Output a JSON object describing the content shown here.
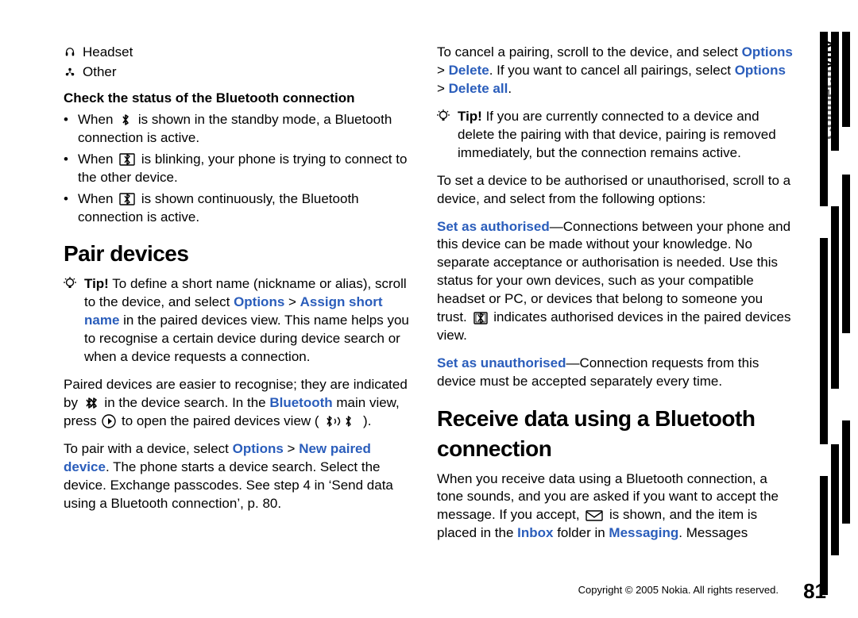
{
  "sidetab": {
    "prefix": "Connecti",
    "suffix": "vity"
  },
  "devlist": [
    {
      "icon": "headset",
      "label": "Headset"
    },
    {
      "icon": "other",
      "label": "Other"
    }
  ],
  "col1": {
    "checkHeading": "Check the status of the Bluetooth connection",
    "bul1a": "When ",
    "bul1b": " is shown in the standby mode, a Bluetooth connection is active.",
    "bul2a": "When ",
    "bul2b": " is blinking, your phone is trying to connect to the other device.",
    "bul3a": "When ",
    "bul3b": " is shown continuously, the Bluetooth connection is active.",
    "pairHeading": "Pair devices",
    "tip1a": "Tip!",
    "tip1b": " To define a short name (nickname or alias), scroll to the device, and select ",
    "tip1c": "Options",
    "tip1d": " > ",
    "tip1e": "Assign short name",
    "tip1f": " in the paired devices view. This name helps you to recognise a certain device during device search or when a device requests a connection.",
    "p1a": "Paired devices are easier to recognise; they are indicated by ",
    "p1b": " in the device search. In the ",
    "p1c": "Bluetooth",
    "p1d": " main view, press ",
    "p1e": " to open the paired devices view ( ",
    "p1f": " ).",
    "p2a": "To pair with a device, select ",
    "p2b": "Options",
    "p2c": " > ",
    "p2d": "New paired device",
    "p2e": ". The phone starts a device search. Select the device. Exchange passcodes. See step 4 in ‘Send data using a Bluetooth connection’, p. 80."
  },
  "col2": {
    "p1a": "To cancel a pairing, scroll to the device, and select ",
    "p1b": "Options",
    "p1c": " > ",
    "p1d": "Delete",
    "p1e": ". If you want to cancel all pairings, select ",
    "p1f": "Options",
    "p1g": " > ",
    "p1h": "Delete all",
    "p1i": ".",
    "tip1a": "Tip!",
    "tip1b": " If you are currently connected to a device and delete the pairing with that device, pairing is removed immediately, but the connection remains active.",
    "p2": "To set a device to be authorised or unauthorised, scroll to a device, and select from the following options:",
    "p3a": "Set as authorised",
    "p3b": "—Connections between your phone and this device can be made without your knowledge. No separate acceptance or authorisation is needed. Use this status for your own devices, such as your compatible headset or PC, or devices that belong to someone you trust. ",
    "p3c": " indicates authorised devices in the paired devices view.",
    "p4a": "Set as unauthorised",
    "p4b": "—Connection requests from this device must be accepted separately every time.",
    "recvHeading": "Receive data using a Bluetooth connection",
    "p5a": "When you receive data using a Bluetooth connection, a tone sounds, and you are asked if you want to accept the message. If you accept, ",
    "p5b": " is shown, and the item is placed in the ",
    "p5c": "Inbox",
    "p5d": " folder in ",
    "p5e": "Messaging",
    "p5f": ". Messages"
  },
  "footer": "Copyright © 2005 Nokia. All rights reserved.",
  "pagenum": "81"
}
